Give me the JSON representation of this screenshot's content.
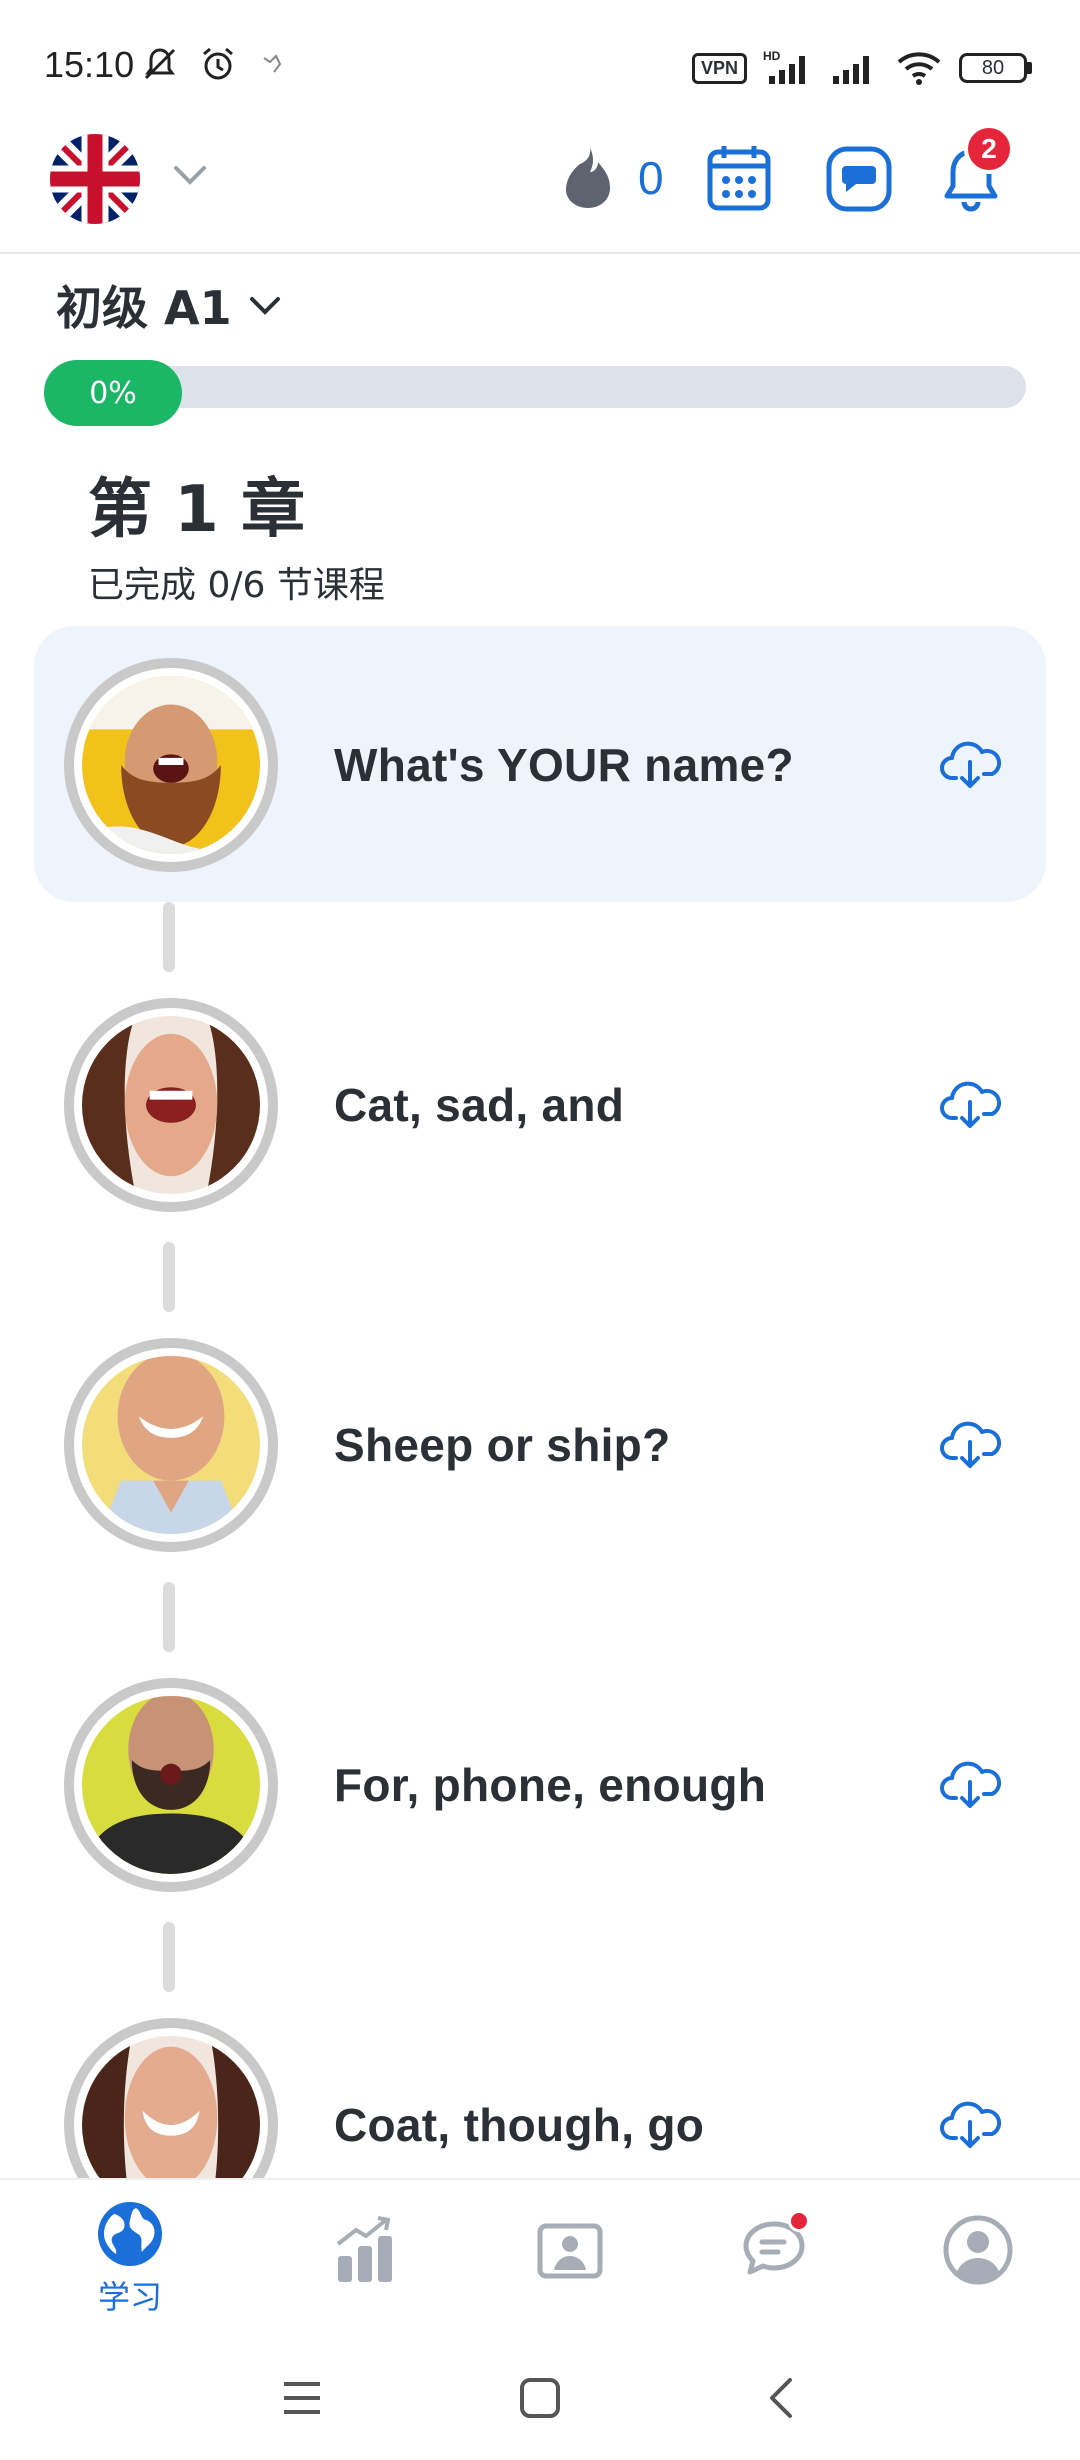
{
  "status_bar": {
    "time": "15:10",
    "vpn_label": "VPN",
    "network_label": "HD",
    "battery": "80"
  },
  "header": {
    "language": "English (UK)",
    "streak_count": "0",
    "notification_count": "2"
  },
  "course": {
    "level": "初级 A1",
    "progress_text": "0%",
    "progress_value": 0
  },
  "chapter": {
    "title": "第 1 章",
    "subtitle": "已完成 0/6 节课程"
  },
  "lessons": [
    {
      "title": "What's YOUR name?",
      "active": true
    },
    {
      "title": "Cat, sad, and",
      "active": false
    },
    {
      "title": "Sheep or ship?",
      "active": false
    },
    {
      "title": "For, phone, enough",
      "active": false
    },
    {
      "title": "Coat, though, go",
      "active": false
    }
  ],
  "bottom_nav": {
    "items": [
      {
        "name": "learn",
        "label": "学习",
        "icon": "globe-icon",
        "active": true
      },
      {
        "name": "progress",
        "icon": "bar-chart-icon"
      },
      {
        "name": "tutors",
        "icon": "id-card-icon"
      },
      {
        "name": "community",
        "icon": "chat-bubbles-icon"
      },
      {
        "name": "profile",
        "icon": "user-avatar-icon"
      }
    ]
  },
  "colors": {
    "accent": "#1a6fd8",
    "progress": "#1bb666",
    "badge": "#e4253a",
    "active_row": "#eef4fb"
  }
}
